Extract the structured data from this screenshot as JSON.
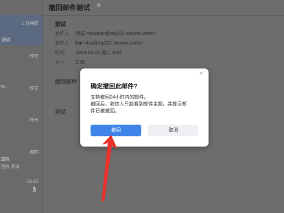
{
  "list": {
    "items": [
      {
        "time": "1 分钟前",
        "preview": "测试",
        "selected": true
      },
      {
        "time": "昨天"
      },
      {
        "time": "昨天",
        "sender": "hu"
      },
      {
        "time": "昨天"
      },
      {
        "time": "周四",
        "sender": "回执",
        "preview": "回执 测试"
      },
      {
        "time": "03-10"
      }
    ]
  },
  "reader": {
    "subject": "撤回邮件测试",
    "mail_title": "测试",
    "meta": {
      "from_label": "发件人",
      "from_value": "测试 <wushan@xty321.wecom.work>",
      "to_label": "收件人",
      "to_name": "hui",
      "to_value": "<hui@xty321.wecom.work>",
      "time_label": "时间",
      "time_value": "2023-03-21 周二 9:54",
      "size_label": "大小",
      "size_value": "2.2K"
    },
    "body_line1": "撤回邮件",
    "body_line2": "测试"
  },
  "dialog": {
    "close": "×",
    "title": "确定撤回此邮件?",
    "text_line1": "支持撤回24小时内的邮件。",
    "text_line2": "撤回后，收信人只能看到邮件主题，并提示邮",
    "text_line3": "件已被撤回。",
    "confirm": "撤回",
    "cancel": "取消"
  },
  "icons": {
    "star": "star-icon",
    "close": "close-icon",
    "attachment": "paperclip-icon"
  },
  "colors": {
    "primary": "#3f85e8",
    "arrow": "#e8322c"
  }
}
